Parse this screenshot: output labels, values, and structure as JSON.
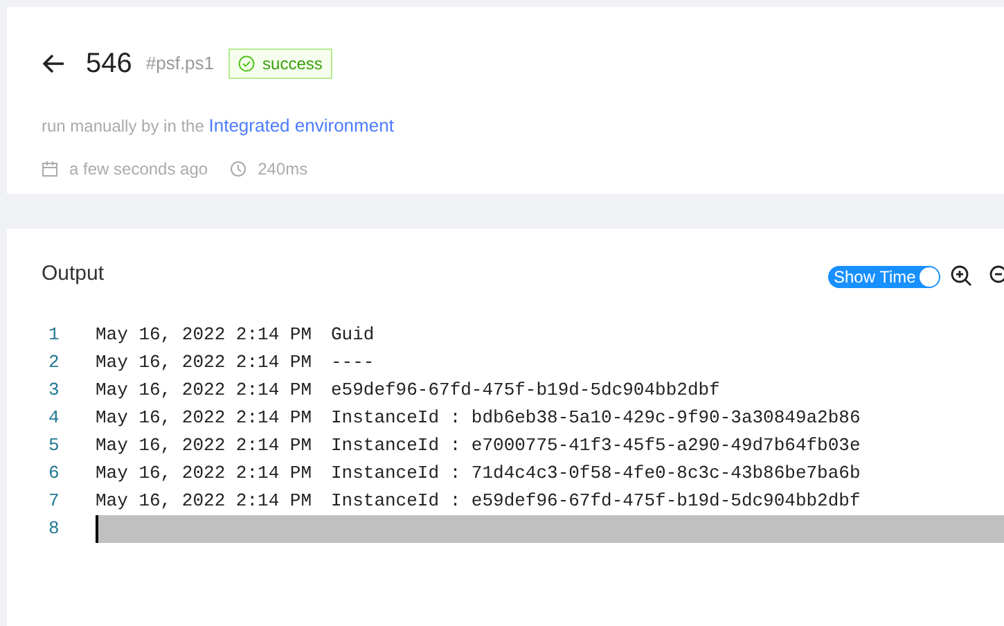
{
  "header": {
    "run_number": "546",
    "script": "#psf.ps1",
    "status": {
      "label": "success",
      "kind": "success"
    },
    "description": "run manually by in the ",
    "environment_link": "Integrated environment",
    "date": "a few seconds ago",
    "duration": "240ms"
  },
  "output": {
    "title": "Output",
    "show_time": {
      "label": "Show Time",
      "on": true
    },
    "lines": [
      {
        "number": "1",
        "time": "May 16, 2022 2:14 PM",
        "text": "Guid",
        "current": false
      },
      {
        "number": "2",
        "time": "May 16, 2022 2:14 PM",
        "text": "----",
        "current": false
      },
      {
        "number": "3",
        "time": "May 16, 2022 2:14 PM",
        "text": "e59def96-67fd-475f-b19d-5dc904bb2dbf",
        "current": false
      },
      {
        "number": "4",
        "time": "May 16, 2022 2:14 PM",
        "text": "InstanceId : bdb6eb38-5a10-429c-9f90-3a30849a2b86",
        "current": false
      },
      {
        "number": "5",
        "time": "May 16, 2022 2:14 PM",
        "text": "InstanceId : e7000775-41f3-45f5-a290-49d7b64fb03e",
        "current": false
      },
      {
        "number": "6",
        "time": "May 16, 2022 2:14 PM",
        "text": "InstanceId : 71d4c4c3-0f58-4fe0-8c3c-43b86be7ba6b",
        "current": false
      },
      {
        "number": "7",
        "time": "May 16, 2022 2:14 PM",
        "text": "InstanceId : e59def96-67fd-475f-b19d-5dc904bb2dbf",
        "current": false
      },
      {
        "number": "8",
        "current": true
      }
    ]
  }
}
